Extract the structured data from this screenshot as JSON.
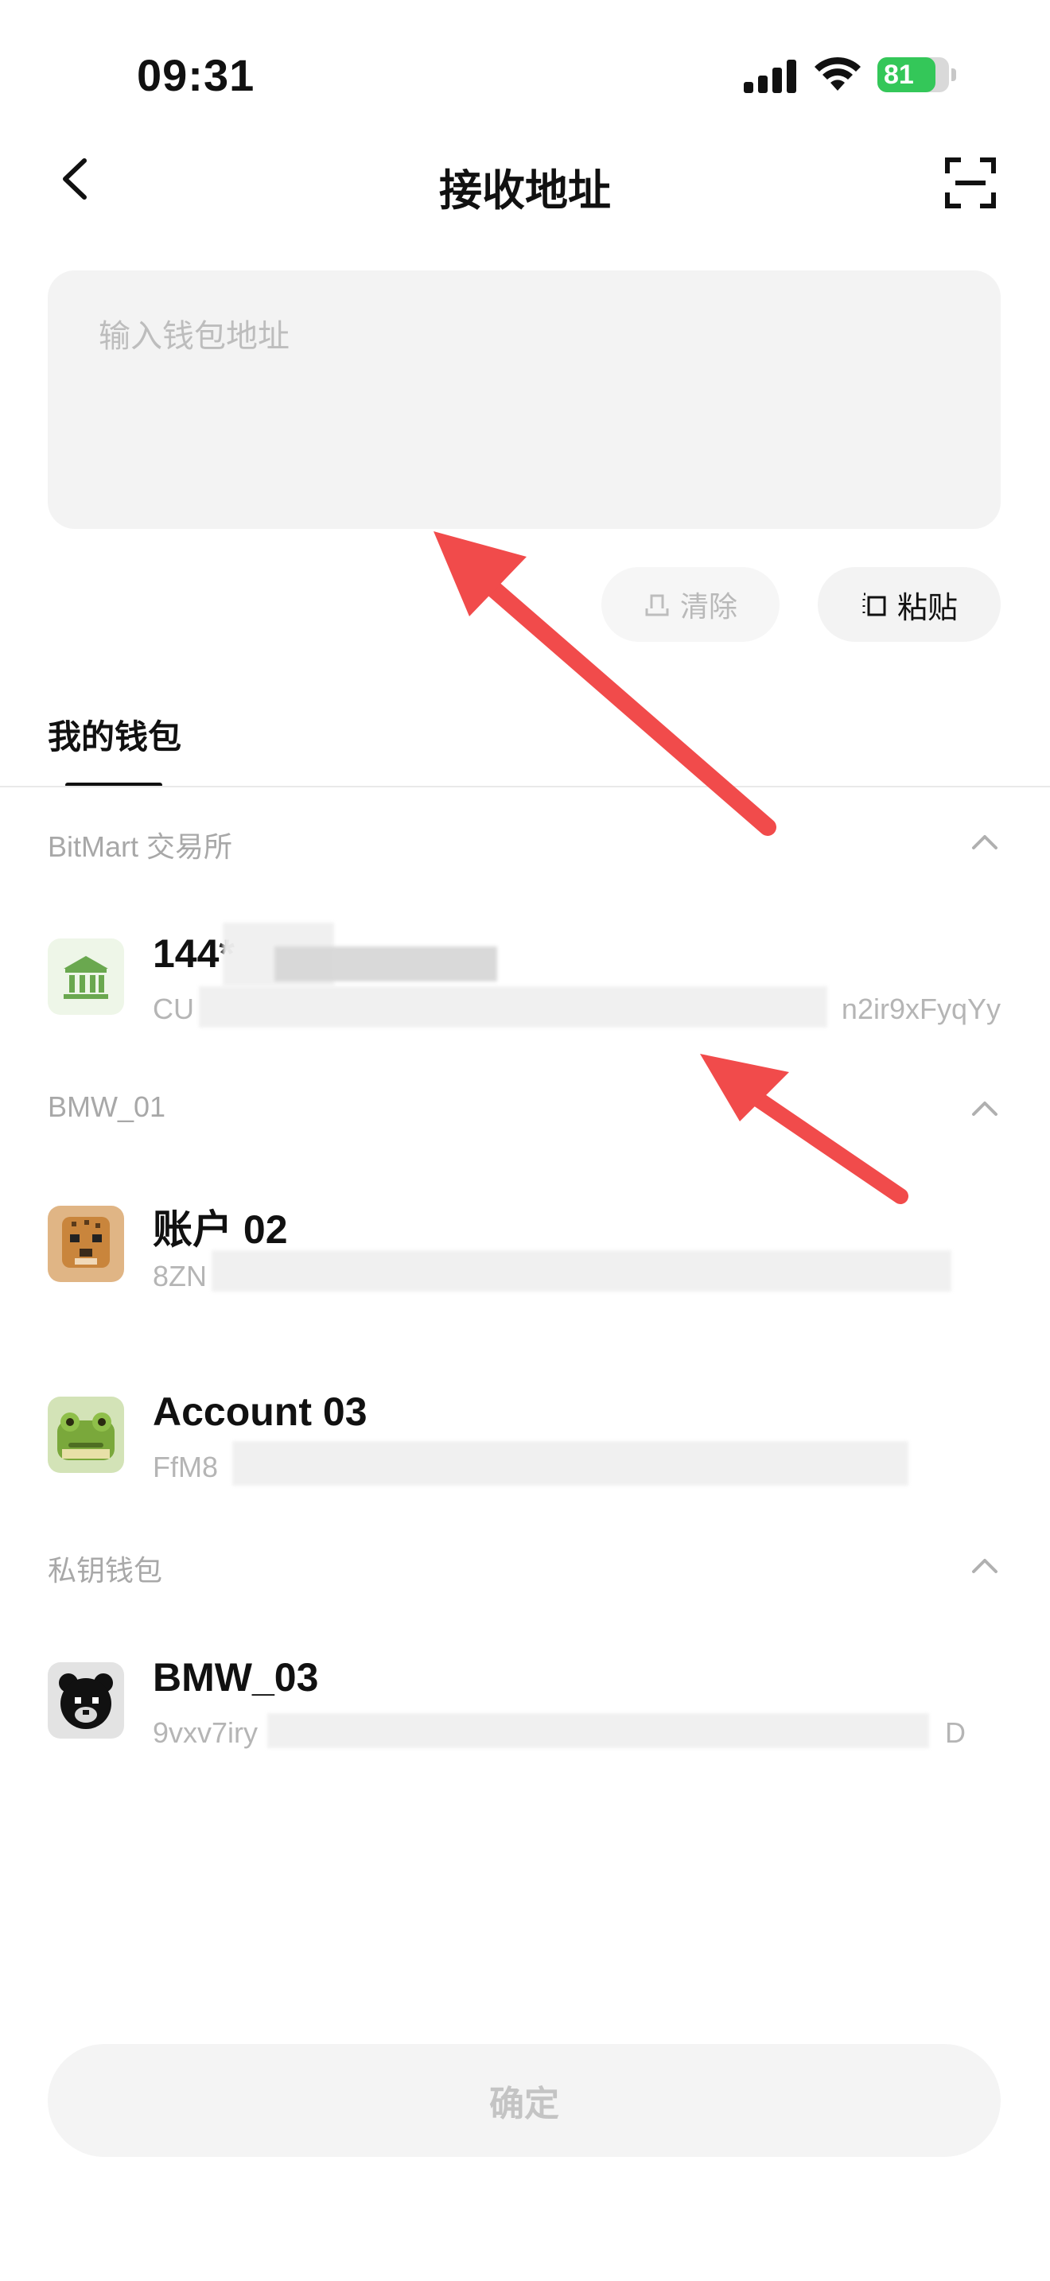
{
  "status_bar": {
    "time": "09:31",
    "battery_percent": "81",
    "battery_level": 0.81
  },
  "header": {
    "title": "接收地址"
  },
  "address_input": {
    "placeholder": "输入钱包地址"
  },
  "actions": {
    "clear_label": "清除",
    "paste_label": "粘贴"
  },
  "tabs": [
    {
      "label": "我的钱包",
      "active": true
    }
  ],
  "groups": [
    {
      "title": "BitMart 交易所",
      "wallets": [
        {
          "name": "144*",
          "address_start": "CU",
          "address_end": "n2ir9xFyqYy",
          "avatar_icon": "bank-icon"
        }
      ]
    },
    {
      "title": "BMW_01",
      "wallets": [
        {
          "name": "账户 02",
          "address_start": "8ZN",
          "address_end": "",
          "avatar_icon": "cheetah-avatar"
        },
        {
          "name": "Account 03",
          "address_start": "FfM8",
          "address_end": "",
          "avatar_icon": "frog-avatar"
        }
      ]
    },
    {
      "title": "私钥钱包",
      "wallets": [
        {
          "name": "BMW_03",
          "address_start": "9vxv7iry",
          "address_end": "D",
          "avatar_icon": "bear-avatar"
        }
      ]
    }
  ],
  "confirm": {
    "label": "确定"
  },
  "colors": {
    "accent_text": "#111111",
    "muted_text": "#a8a8a8",
    "input_bg": "#f3f3f3",
    "annotation_arrow": "#f14b4b",
    "bank_green": "#6aa84f"
  }
}
